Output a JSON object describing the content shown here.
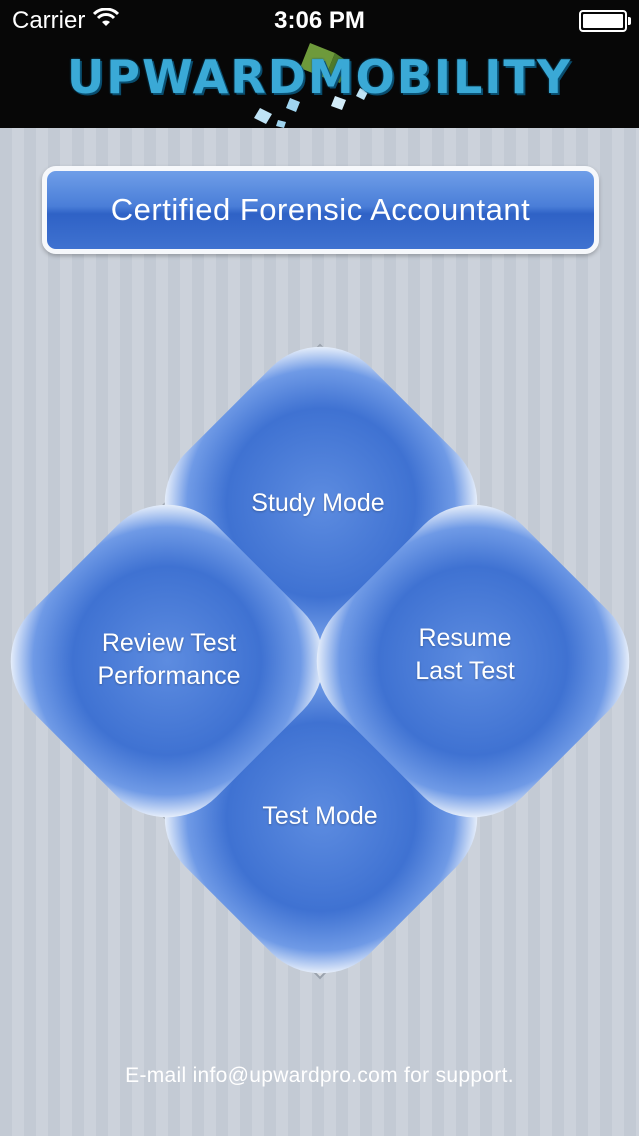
{
  "status_bar": {
    "carrier": "Carrier",
    "time": "3:06 PM",
    "wifi_icon": "wifi-icon",
    "battery_icon": "battery-icon"
  },
  "header": {
    "logo_text": "UPWARDMOBILITY"
  },
  "title_button": {
    "label": "Certified Forensic Accountant"
  },
  "menu": {
    "study_mode": "Study Mode",
    "review_line1": "Review Test",
    "review_line2": "Performance",
    "resume_line1": "Resume",
    "resume_line2": "Last Test",
    "test_mode": "Test Mode"
  },
  "footer": {
    "support_text": "E-mail info@upwardpro.com for support."
  },
  "colors": {
    "header_bg": "#070707",
    "logo_blue": "#3aa9d6",
    "button_blue": "#4a7ed8",
    "background": "#c8ced7"
  }
}
